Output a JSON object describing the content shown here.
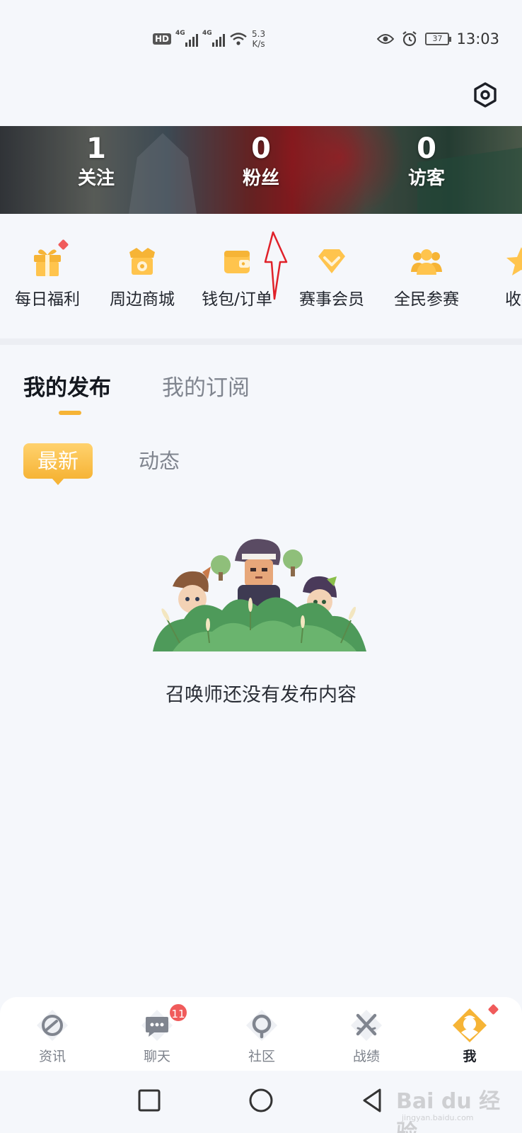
{
  "status_bar": {
    "hd": "HD",
    "net1": "4G",
    "net2": "4G",
    "speed_value": "5.3",
    "speed_unit": "K/s",
    "battery": "37",
    "time": "13:03"
  },
  "stats": [
    {
      "value": "1",
      "label": "关注"
    },
    {
      "value": "0",
      "label": "粉丝"
    },
    {
      "value": "0",
      "label": "访客"
    }
  ],
  "quick_menu": [
    {
      "label": "每日福利",
      "icon": "gift-icon",
      "dot": true
    },
    {
      "label": "周边商城",
      "icon": "shop-icon",
      "dot": false
    },
    {
      "label": "钱包/订单",
      "icon": "wallet-icon",
      "dot": false
    },
    {
      "label": "赛事会员",
      "icon": "diamond-icon",
      "dot": false
    },
    {
      "label": "全民参赛",
      "icon": "team-icon",
      "dot": false
    },
    {
      "label": "收藏",
      "icon": "star-icon",
      "dot": false
    }
  ],
  "tabs": [
    {
      "label": "我的发布",
      "active": true
    },
    {
      "label": "我的订阅",
      "active": false
    }
  ],
  "sub_tabs": [
    {
      "label": "最新",
      "active": true
    },
    {
      "label": "动态",
      "active": false
    }
  ],
  "empty_state": {
    "text": "召唤师还没有发布内容"
  },
  "bottom_nav": [
    {
      "label": "资讯",
      "icon": "news-icon",
      "active": false
    },
    {
      "label": "聊天",
      "icon": "chat-icon",
      "active": false,
      "badge": "11"
    },
    {
      "label": "社区",
      "icon": "community-icon",
      "active": false
    },
    {
      "label": "战绩",
      "icon": "swords-icon",
      "active": false
    },
    {
      "label": "我",
      "icon": "me-icon",
      "active": true,
      "dot": true
    }
  ],
  "watermark": {
    "main": "Bai du 经验",
    "sub": "jingyan.baidu.com"
  },
  "colors": {
    "accent": "#f6b436",
    "badge": "#f05b5b",
    "background": "#f5f7fb"
  }
}
